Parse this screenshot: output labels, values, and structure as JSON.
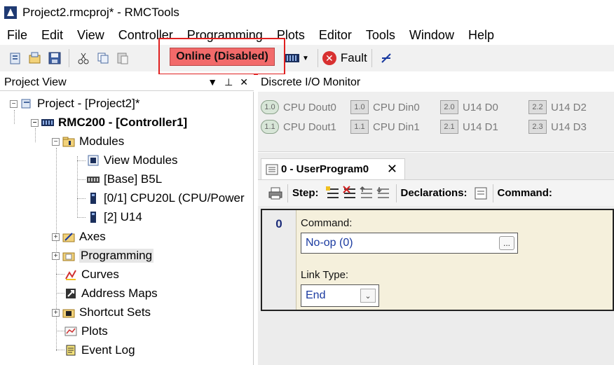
{
  "window": {
    "title": "Project2.rmcproj* - RMCTools"
  },
  "menu": [
    "File",
    "Edit",
    "View",
    "Controller",
    "Programming",
    "Plots",
    "Editor",
    "Tools",
    "Window",
    "Help"
  ],
  "toolbar": {
    "online_label": "Online (Disabled)",
    "fault_label": "Fault",
    "highlight_color": "#e02020",
    "online_bg": "#f26a6a"
  },
  "project_view": {
    "title": "Project View",
    "pin_glyph": "▼ ⊥ ✕",
    "tree": {
      "project": "Project - [Project2]*",
      "controller": "RMC200 - [Controller1]",
      "modules": "Modules",
      "view_modules": "View Modules",
      "base": "[Base] B5L",
      "cpu": "[0/1] CPU20L (CPU/Power",
      "u14": "[2] U14",
      "axes": "Axes",
      "programming": "Programming",
      "curves": "Curves",
      "address_maps": "Address Maps",
      "shortcut_sets": "Shortcut Sets",
      "plots": "Plots",
      "event_log": "Event Log"
    }
  },
  "io_monitor": {
    "title": "Discrete I/O Monitor",
    "items": [
      {
        "badge": "1.0",
        "label": "CPU Dout0"
      },
      {
        "badge": "1.0",
        "label": "CPU Din0"
      },
      {
        "badge": "2.0",
        "label": "U14 D0"
      },
      {
        "badge": "2.2",
        "label": "U14 D2"
      },
      {
        "badge": "1.1",
        "label": "CPU Dout1"
      },
      {
        "badge": "1.1",
        "label": "CPU Din1"
      },
      {
        "badge": "2.1",
        "label": "U14 D1"
      },
      {
        "badge": "2.3",
        "label": "U14 D3"
      }
    ]
  },
  "editor": {
    "tab_label": "0 - UserProgram0",
    "tab_close": "✕",
    "step_label": "Step:",
    "declarations_label": "Declarations:",
    "command_label": "Command:",
    "step_number": "0",
    "command_field_label": "Command:",
    "command_value": "No-op (0)",
    "ellipsis": "...",
    "link_type_label": "Link Type:",
    "link_type_value": "End"
  }
}
